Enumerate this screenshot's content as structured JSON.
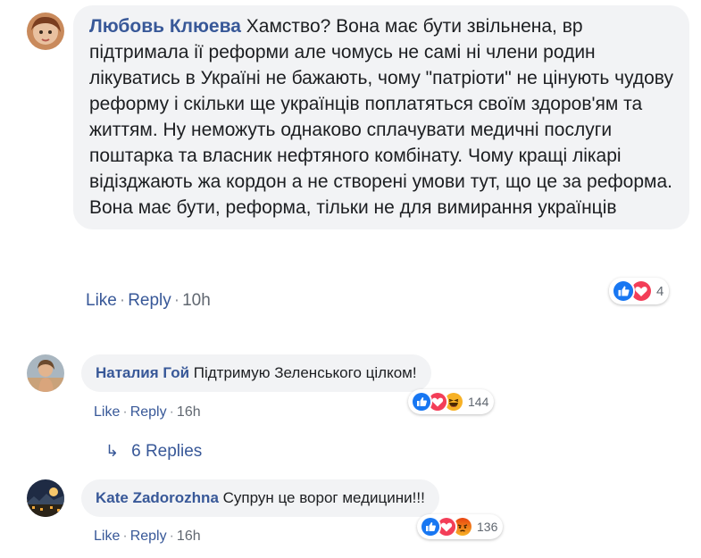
{
  "comments": [
    {
      "author": "Любовь Клюева",
      "text": "Хамство? Вона має бути звільнена, вр підтримала ії реформи але чомусь не самі ні члени родин лікуватись в Україні не бажають, чому \"патріоти\" не цінують чудову реформу і скільки ще українців поплатяться своїм здоров'ям та життям. Ну неможуть однаково сплачувати медичні послуги поштарка та власник нефтяного комбінату. Чому кращі лікарі відізджають жа кордон а не створені умови тут, що це за реформа. Вона має бути, реформа, тільки не для вимирання українців",
      "like": "Like",
      "reply": "Reply",
      "time": "10h",
      "reaction_count": "4",
      "reaction_icons": [
        "like-icon",
        "love-icon"
      ]
    },
    {
      "author": "Наталия Гой",
      "text": "Підтримую Зеленського цілком!",
      "like": "Like",
      "reply": "Reply",
      "time": "16h",
      "reaction_count": "144",
      "reaction_icons": [
        "like-icon",
        "love-icon",
        "haha-icon"
      ],
      "replies_label": "6 Replies"
    },
    {
      "author": "Kate Zadorozhna",
      "text": "Супрун це ворог медицини!!!",
      "like": "Like",
      "reply": "Reply",
      "time": "16h",
      "reaction_count": "136",
      "reaction_icons": [
        "like-icon",
        "love-icon",
        "angry-icon"
      ]
    }
  ],
  "colors": {
    "author": "#385898",
    "bubble": "#f2f3f5",
    "like": "#1877f2",
    "love": "#f33e58",
    "haha": "#f7b125",
    "angry": "#e9710f"
  }
}
